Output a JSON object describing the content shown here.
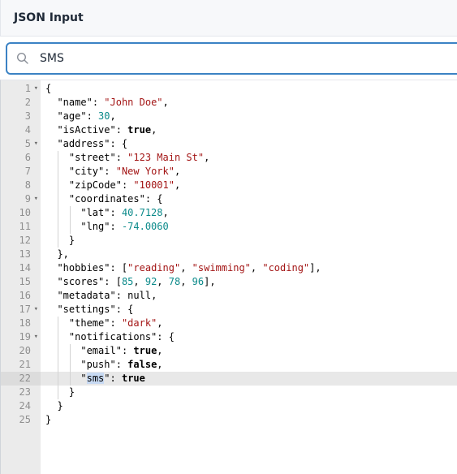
{
  "panel": {
    "title": "JSON Input"
  },
  "search": {
    "value": "SMS",
    "placeholder": ""
  },
  "editor": {
    "active_line": 22,
    "lines": [
      {
        "n": "1",
        "fold": true
      },
      {
        "n": "2"
      },
      {
        "n": "3"
      },
      {
        "n": "4"
      },
      {
        "n": "5",
        "fold": true
      },
      {
        "n": "6"
      },
      {
        "n": "7"
      },
      {
        "n": "8"
      },
      {
        "n": "9",
        "fold": true
      },
      {
        "n": "10"
      },
      {
        "n": "11"
      },
      {
        "n": "12"
      },
      {
        "n": "13"
      },
      {
        "n": "14"
      },
      {
        "n": "15"
      },
      {
        "n": "16"
      },
      {
        "n": "17",
        "fold": true
      },
      {
        "n": "18"
      },
      {
        "n": "19",
        "fold": true
      },
      {
        "n": "20"
      },
      {
        "n": "21"
      },
      {
        "n": "22"
      },
      {
        "n": "23"
      },
      {
        "n": "24"
      },
      {
        "n": "25"
      }
    ],
    "tokens": {
      "name_key": "\"name\"",
      "name_val": "\"John Doe\"",
      "age_key": "\"age\"",
      "age_val": "30",
      "isActive_key": "\"isActive\"",
      "isActive_val": "true",
      "address_key": "\"address\"",
      "street_key": "\"street\"",
      "street_val": "\"123 Main St\"",
      "city_key": "\"city\"",
      "city_val": "\"New York\"",
      "zip_key": "\"zipCode\"",
      "zip_val": "\"10001\"",
      "coords_key": "\"coordinates\"",
      "lat_key": "\"lat\"",
      "lat_val": "40.7128",
      "lng_key": "\"lng\"",
      "lng_val": "-74.0060",
      "hobbies_key": "\"hobbies\"",
      "hobby1": "\"reading\"",
      "hobby2": "\"swimming\"",
      "hobby3": "\"coding\"",
      "scores_key": "\"scores\"",
      "score1": "85",
      "score2": "92",
      "score3": "78",
      "score4": "96",
      "metadata_key": "\"metadata\"",
      "metadata_val": "null",
      "settings_key": "\"settings\"",
      "theme_key": "\"theme\"",
      "theme_val": "\"dark\"",
      "notif_key": "\"notifications\"",
      "email_key": "\"email\"",
      "email_val": "true",
      "push_key": "\"push\"",
      "push_val": "false",
      "sms_key_open": "\"",
      "sms_key_match": "sms",
      "sms_key_close": "\"",
      "sms_val": "true"
    }
  },
  "icons": {
    "search": "search-icon",
    "fold": "fold-chevron-icon"
  },
  "colors": {
    "accent": "#3b82c4",
    "string": "#a31515",
    "number": "#0b8a8a",
    "match": "#c8daf3"
  }
}
